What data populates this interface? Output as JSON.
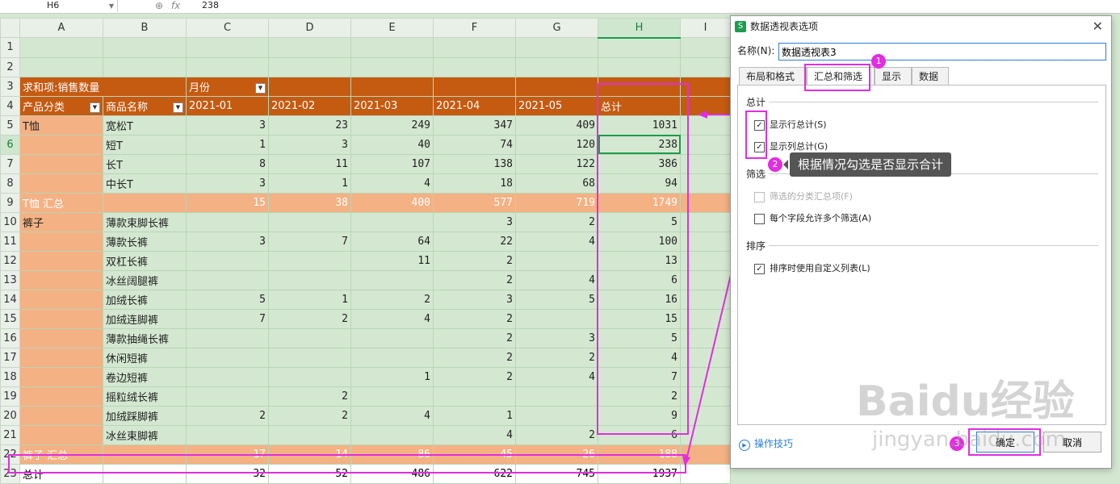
{
  "formula_bar": {
    "cell_ref": "H6",
    "fx_label": "fx",
    "value": "238"
  },
  "columns": [
    "A",
    "B",
    "C",
    "D",
    "E",
    "F",
    "G",
    "H",
    "I"
  ],
  "pivot": {
    "row3": {
      "label": "求和项:销售数量",
      "month_label": "月份"
    },
    "row4": {
      "cat": "产品分类",
      "name": "商品名称",
      "months": [
        "2021-01",
        "2021-02",
        "2021-03",
        "2021-04",
        "2021-05"
      ],
      "total": "总计"
    },
    "rows": [
      {
        "r": "5",
        "cat": "T恤",
        "name": "宽松T",
        "v": [
          "3",
          "23",
          "249",
          "347",
          "409"
        ],
        "t": "1031",
        "type": "data"
      },
      {
        "r": "6",
        "cat": "",
        "name": "短T",
        "v": [
          "1",
          "3",
          "40",
          "74",
          "120"
        ],
        "t": "238",
        "type": "data"
      },
      {
        "r": "7",
        "cat": "",
        "name": "长T",
        "v": [
          "8",
          "11",
          "107",
          "138",
          "122"
        ],
        "t": "386",
        "type": "data"
      },
      {
        "r": "8",
        "cat": "",
        "name": "中长T",
        "v": [
          "3",
          "1",
          "4",
          "18",
          "68"
        ],
        "t": "94",
        "type": "data"
      },
      {
        "r": "9",
        "cat": "T恤 汇总",
        "name": "",
        "v": [
          "15",
          "38",
          "400",
          "577",
          "719"
        ],
        "t": "1749",
        "type": "sub"
      },
      {
        "r": "10",
        "cat": "裤子",
        "name": "薄款束脚长裤",
        "v": [
          "",
          "",
          "",
          "3",
          "2"
        ],
        "t": "5",
        "type": "data"
      },
      {
        "r": "11",
        "cat": "",
        "name": "薄款长裤",
        "v": [
          "3",
          "7",
          "64",
          "22",
          "4"
        ],
        "t": "100",
        "type": "data"
      },
      {
        "r": "12",
        "cat": "",
        "name": "双杠长裤",
        "v": [
          "",
          "",
          "11",
          "2",
          ""
        ],
        "t": "13",
        "type": "data"
      },
      {
        "r": "13",
        "cat": "",
        "name": "冰丝阔腿裤",
        "v": [
          "",
          "",
          "",
          "2",
          "4"
        ],
        "t": "6",
        "type": "data"
      },
      {
        "r": "14",
        "cat": "",
        "name": "加绒长裤",
        "v": [
          "5",
          "1",
          "2",
          "3",
          "5"
        ],
        "t": "16",
        "type": "data"
      },
      {
        "r": "15",
        "cat": "",
        "name": "加绒连脚裤",
        "v": [
          "7",
          "2",
          "4",
          "2",
          ""
        ],
        "t": "15",
        "type": "data"
      },
      {
        "r": "16",
        "cat": "",
        "name": "薄款抽绳长裤",
        "v": [
          "",
          "",
          "",
          "2",
          "3"
        ],
        "t": "5",
        "type": "data"
      },
      {
        "r": "17",
        "cat": "",
        "name": "休闲短裤",
        "v": [
          "",
          "",
          "",
          "2",
          "2"
        ],
        "t": "4",
        "type": "data"
      },
      {
        "r": "18",
        "cat": "",
        "name": "卷边短裤",
        "v": [
          "",
          "",
          "1",
          "2",
          "4"
        ],
        "t": "7",
        "type": "data"
      },
      {
        "r": "19",
        "cat": "",
        "name": "摇粒绒长裤",
        "v": [
          "",
          "2",
          "",
          "",
          ""
        ],
        "t": "2",
        "type": "data"
      },
      {
        "r": "20",
        "cat": "",
        "name": "加绒踩脚裤",
        "v": [
          "2",
          "2",
          "4",
          "1",
          ""
        ],
        "t": "9",
        "type": "data"
      },
      {
        "r": "21",
        "cat": "",
        "name": "冰丝束脚裤",
        "v": [
          "",
          "",
          "",
          "4",
          "2"
        ],
        "t": "6",
        "type": "data"
      },
      {
        "r": "22",
        "cat": "裤子 汇总",
        "name": "",
        "v": [
          "17",
          "14",
          "86",
          "45",
          "26"
        ],
        "t": "188",
        "type": "sub"
      },
      {
        "r": "23",
        "cat": "总计",
        "name": "",
        "v": [
          "32",
          "52",
          "486",
          "622",
          "745"
        ],
        "t": "1937",
        "type": "tot"
      }
    ]
  },
  "dialog": {
    "title": "数据透视表选项",
    "name_label": "名称(N):",
    "name_value": "数据透视表3",
    "tabs": [
      "布局和格式",
      "汇总和筛选",
      "显示",
      "数据"
    ],
    "sec_total": "总计",
    "cb_row_total": "显示行总计(S)",
    "cb_col_total": "显示列总计(G)",
    "sec_filter": "筛选",
    "cb_filter_sub": "筛选的分类汇总项(F)",
    "cb_multi_filter": "每个字段允许多个筛选(A)",
    "sec_sort": "排序",
    "cb_custom_sort": "排序时使用自定义列表(L)",
    "tips": "操作技巧",
    "ok": "确定",
    "cancel": "取消"
  },
  "annotations": {
    "badge1": "1",
    "badge2": "2",
    "badge3": "3",
    "tooltip": "根据情况勾选是否显示合计"
  },
  "watermark": {
    "main": "Baidu经验",
    "sub": "jingyan.baidu.com"
  },
  "colors": {
    "header": "#c55a11",
    "subtotal": "#f4b183",
    "sheet_bg": "#d4e8d1",
    "mark": "#e02ee0"
  }
}
